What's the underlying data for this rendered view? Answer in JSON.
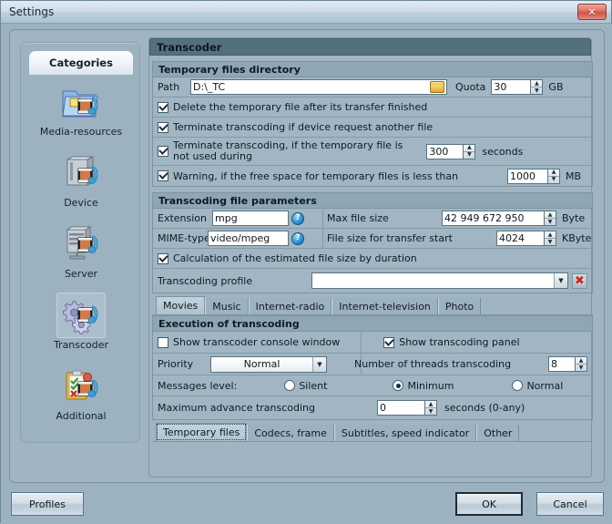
{
  "window": {
    "title": "Settings",
    "close_label": "✕"
  },
  "sidebar": {
    "header": "Categories",
    "items": [
      {
        "label": "Media-resources",
        "icon": "folder-media-icon",
        "selected": false
      },
      {
        "label": "Device",
        "icon": "device-media-icon",
        "selected": false
      },
      {
        "label": "Server",
        "icon": "server-media-icon",
        "selected": false
      },
      {
        "label": "Transcoder",
        "icon": "gears-media-icon",
        "selected": true
      },
      {
        "label": "Additional",
        "icon": "clipboard-media-icon",
        "selected": false
      }
    ]
  },
  "panel": {
    "title": "Transcoder"
  },
  "temp_files": {
    "title": "Temporary files directory",
    "path_label": "Path",
    "path_value": "D:\\_TC",
    "browse_icon": "folder-open-icon",
    "quota_label": "Quota",
    "quota_value": "30",
    "quota_unit": "GB",
    "delete_after_transfer": {
      "label": "Delete the temporary file after its transfer finished",
      "checked": true
    },
    "terminate_on_request": {
      "label": "Terminate transcoding if device request another file",
      "checked": true
    },
    "terminate_unused": {
      "label_line1": "Terminate transcoding, if the temporary file is",
      "label_line2": "not used during",
      "checked": true,
      "value": "300",
      "unit": "seconds"
    },
    "free_space_warning": {
      "label": "Warning, if the free space for temporary files is less than",
      "checked": true,
      "value": "1000",
      "unit": "MB"
    }
  },
  "file_params": {
    "title": "Transcoding file parameters",
    "extension_label": "Extension",
    "extension_value": "mpg",
    "mime_label": "MIME-type",
    "mime_value": "video/mpeg",
    "help_glyph": "?",
    "max_file_size_label": "Max file size",
    "max_file_size_value": "42 949 672 950",
    "max_file_size_unit": "Byte",
    "transfer_start_label": "File size for transfer start",
    "transfer_start_value": "4024",
    "transfer_start_unit": "KByte",
    "calc_estimated": {
      "label": "Calculation of the estimated file size by duration",
      "checked": true
    },
    "profile_label": "Transcoding profile",
    "profile_value": "",
    "profile_delete_icon": "delete-red-x-icon"
  },
  "media_tabs": {
    "items": [
      "Movies",
      "Music",
      "Internet-radio",
      "Internet-television",
      "Photo"
    ],
    "active_index": 0
  },
  "execution": {
    "title": "Execution of transcoding",
    "show_console": {
      "label": "Show transcoder console window",
      "checked": false
    },
    "show_panel": {
      "label": "Show transcoding panel",
      "checked": true
    },
    "priority_label": "Priority",
    "priority_value": "Normal",
    "threads_label": "Number of threads transcoding",
    "threads_value": "8",
    "messages_label": "Messages level:",
    "messages_options": [
      {
        "label": "Silent",
        "selected": false
      },
      {
        "label": "Minimum",
        "selected": true
      },
      {
        "label": "Normal",
        "selected": false
      }
    ],
    "max_advance_label": "Maximum advance transcoding",
    "max_advance_value": "0",
    "max_advance_unit": "seconds (0-any)"
  },
  "bottom_tabs": {
    "items": [
      "Temporary files",
      "Codecs, frame",
      "Subtitles, speed indicator",
      "Other"
    ],
    "active_index": 0
  },
  "buttons": {
    "profiles": "Profiles",
    "ok": "OK",
    "cancel": "Cancel"
  },
  "colors": {
    "window_bg": "#9db2c0",
    "panel_header": "#53707f",
    "group_header": "#8fa6b4",
    "close_red": "#cf5343",
    "accent_blue": "#2b8fd4",
    "delete_red": "#cc2a1b"
  }
}
